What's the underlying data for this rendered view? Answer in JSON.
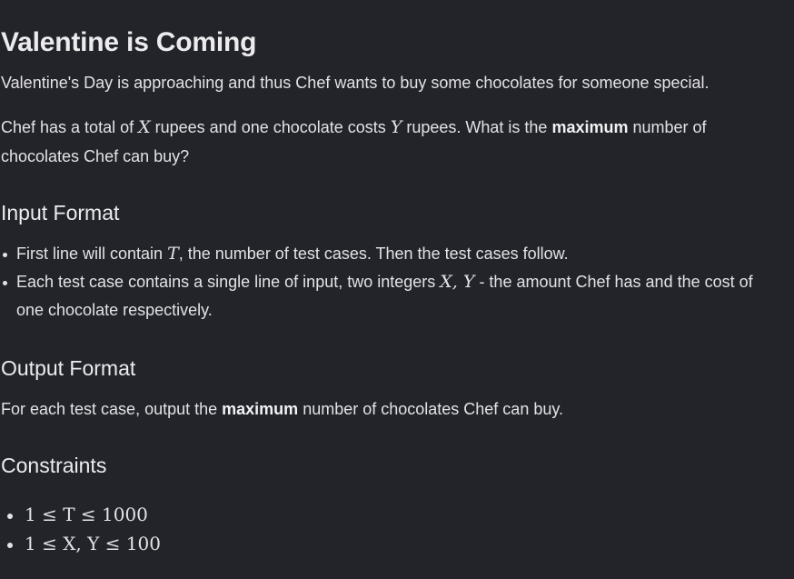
{
  "problem": {
    "title": "Valentine is Coming",
    "intro": "Valentine's Day is approaching and thus Chef wants to buy some chocolates for someone special.",
    "statement": {
      "part1": "Chef has a total of ",
      "var_x": "X",
      "part2": " rupees and one chocolate costs ",
      "var_y": "Y",
      "part3": " rupees. What is the ",
      "bold": "maximum",
      "part4": " number of chocolates Chef can buy?"
    }
  },
  "input_format": {
    "heading": "Input Format",
    "items": [
      {
        "part1": "First line will contain ",
        "math": "T",
        "part2": ", the number of test cases. Then the test cases follow."
      },
      {
        "part1": "Each test case contains a single line of input, two integers ",
        "math": "X, Y",
        "part2": " - the amount Chef has and the cost of one chocolate respectively."
      }
    ]
  },
  "output_format": {
    "heading": "Output Format",
    "part1": "For each test case, output the ",
    "bold": "maximum",
    "part2": " number of chocolates Chef can buy."
  },
  "constraints": {
    "heading": "Constraints",
    "items": [
      "1 ≤ T ≤ 1000",
      "1 ≤ X, Y ≤ 100"
    ]
  }
}
